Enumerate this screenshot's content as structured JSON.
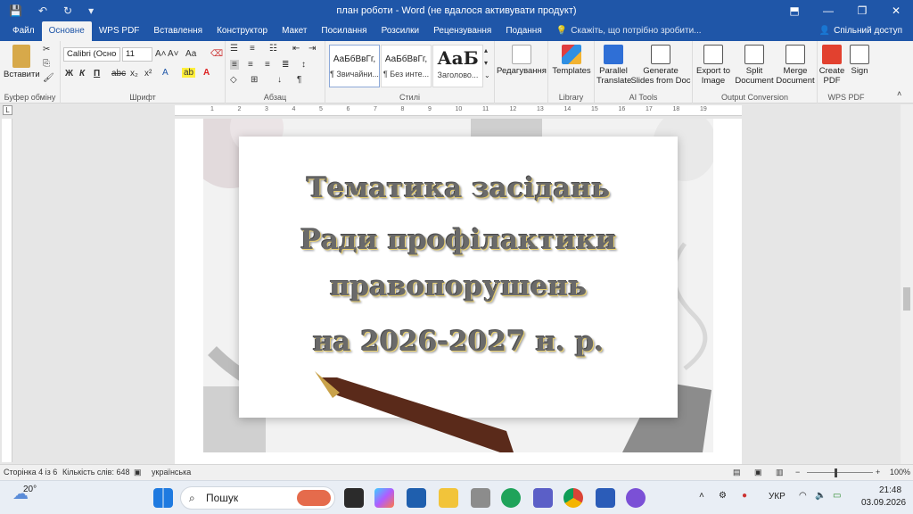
{
  "window": {
    "title": "план роботи - Word (не вдалося активувати продукт)"
  },
  "tabs": [
    "Файл",
    "Основне",
    "WPS PDF",
    "Вставлення",
    "Конструктор",
    "Макет",
    "Посилання",
    "Розсилки",
    "Рецензування",
    "Подання"
  ],
  "tellme": "Скажіть, що потрібно зробити...",
  "share": "Спільний доступ",
  "ribbon": {
    "clipboard": {
      "paste": "Вставити",
      "label": "Буфер обміну"
    },
    "font": {
      "name": "Calibri (Осно",
      "size": "11",
      "label": "Шрифт",
      "bold": "Ж",
      "italic": "К",
      "underline": "П",
      "strike": "abc",
      "sub": "x₂",
      "sup": "x²",
      "grow": "A˄",
      "shrink": "A˅",
      "case": "Аа"
    },
    "paragraph": {
      "label": "Абзац"
    },
    "styles": {
      "items": [
        {
          "preview": "АаБбВвГг,",
          "name": "¶ Звичайни..."
        },
        {
          "preview": "АаБбВвГг,",
          "name": "¶ Без инте..."
        },
        {
          "preview": "АаБ",
          "name": "Заголово..."
        }
      ],
      "label": "Стилі"
    },
    "editing": {
      "label": "Редагування"
    },
    "library": {
      "templates": "Templates",
      "label": "Library"
    },
    "ai": {
      "parallel": "Parallel Translate",
      "slides": "Generate Slides from Doc",
      "label": "AI Tools"
    },
    "output": {
      "export": "Export to Image",
      "split": "Split Document",
      "merge": "Merge Document",
      "label": "Output Conversion"
    },
    "wps": {
      "create": "Create PDF",
      "sign": "Sign",
      "label": "WPS PDF"
    }
  },
  "document": {
    "lines": [
      "Тематика засідань",
      "Ради профілактики",
      "правопорушень",
      "на 2026-2027 н. р."
    ]
  },
  "ruler": {
    "ticks": [
      "1",
      "2",
      "3",
      "4",
      "5",
      "6",
      "7",
      "8",
      "9",
      "10",
      "11",
      "12",
      "13",
      "14",
      "15",
      "16",
      "17",
      "18",
      "19"
    ]
  },
  "status": {
    "page": "Сторінка 4 із 6",
    "words": "Кількість слів: 648",
    "lang": "українська",
    "zoom": "100%"
  },
  "taskbar": {
    "weather": "20°",
    "search": "Пошук",
    "lang": "УКР",
    "time": "21:48",
    "date": "03.09.2026"
  },
  "colors": {
    "accent": "#1f56a8",
    "title_text": "#6a6a6a",
    "title_outline": "#e7cf72"
  }
}
